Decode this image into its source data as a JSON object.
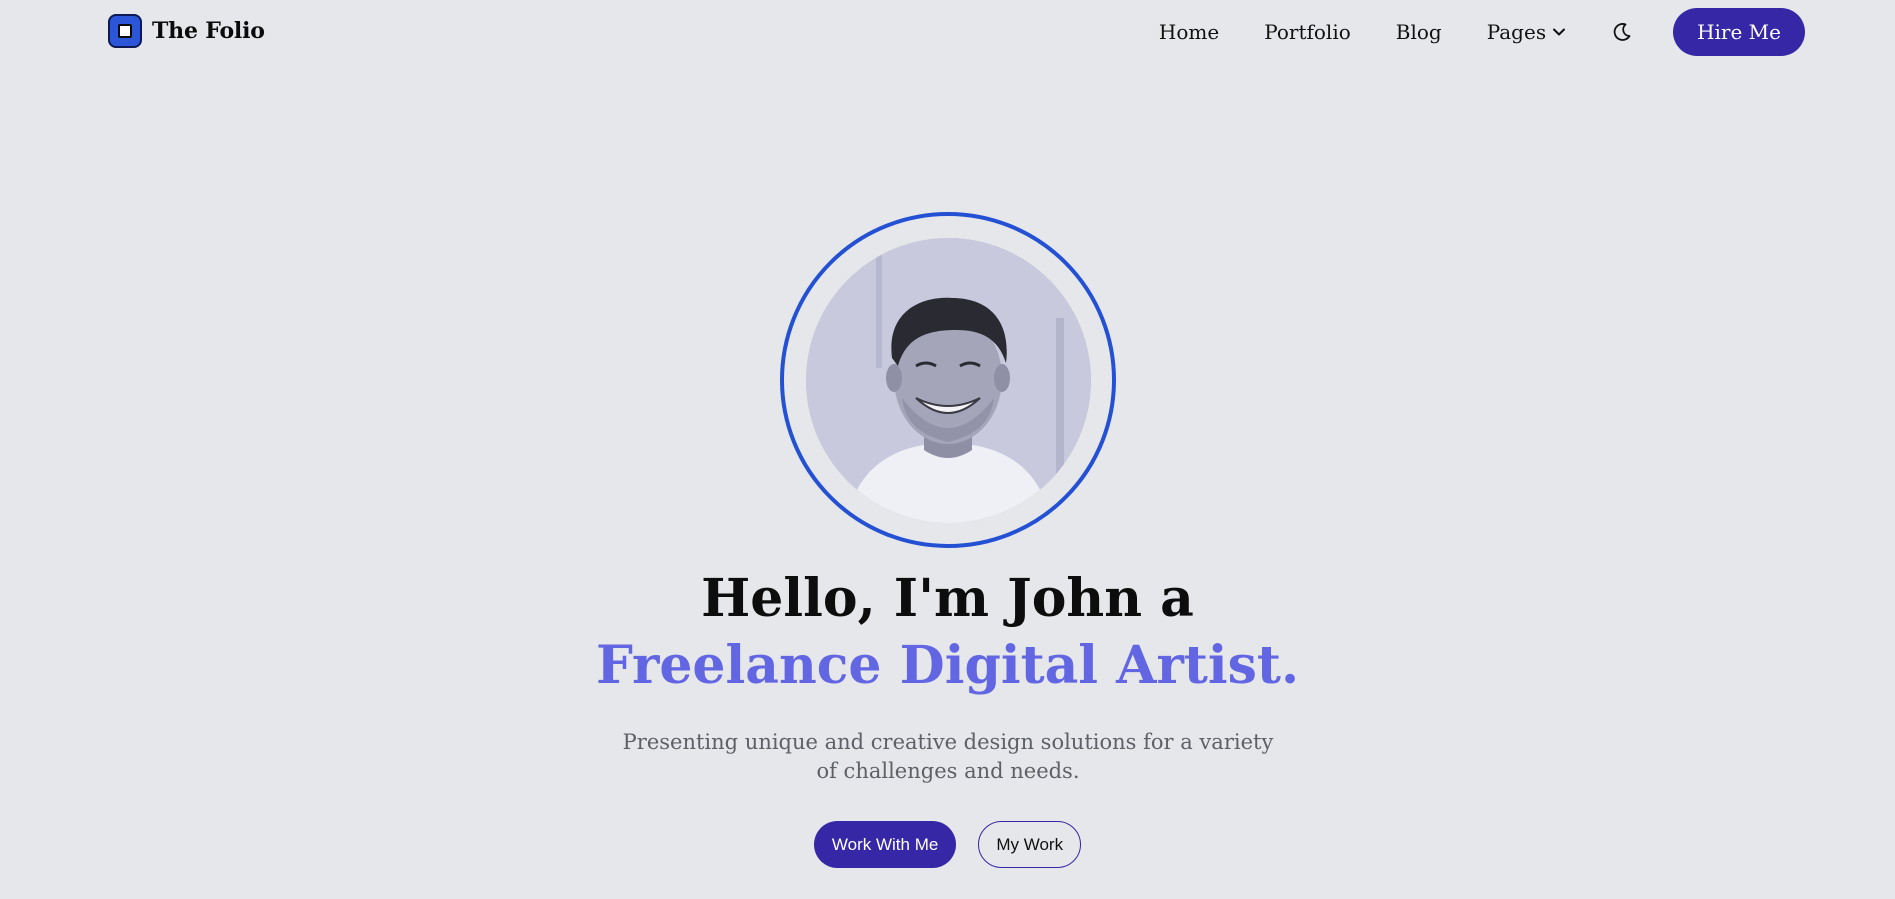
{
  "brand": {
    "name": "The Folio",
    "logo_icon": "square-logo-icon",
    "accent": "#2b56d8"
  },
  "nav": {
    "items": [
      {
        "label": "Home"
      },
      {
        "label": "Portfolio"
      },
      {
        "label": "Blog"
      },
      {
        "label": "Pages",
        "icon": "chevron-down-icon"
      }
    ],
    "theme_toggle_icon": "moon-icon",
    "cta_label": "Hire Me"
  },
  "hero": {
    "avatar_icon": "profile-photo",
    "headline_line1": "Hello, I'm John a",
    "headline_line2": "Freelance Digital Artist.",
    "subtitle": "Presenting unique and creative design solutions for a variety of challenges and needs.",
    "primary_button": "Work With Me",
    "secondary_button": "My Work"
  },
  "colors": {
    "background": "#e5e7ea",
    "primary": "#3527a5",
    "highlight_text": "#6266e2",
    "ring": "#2451d4"
  }
}
